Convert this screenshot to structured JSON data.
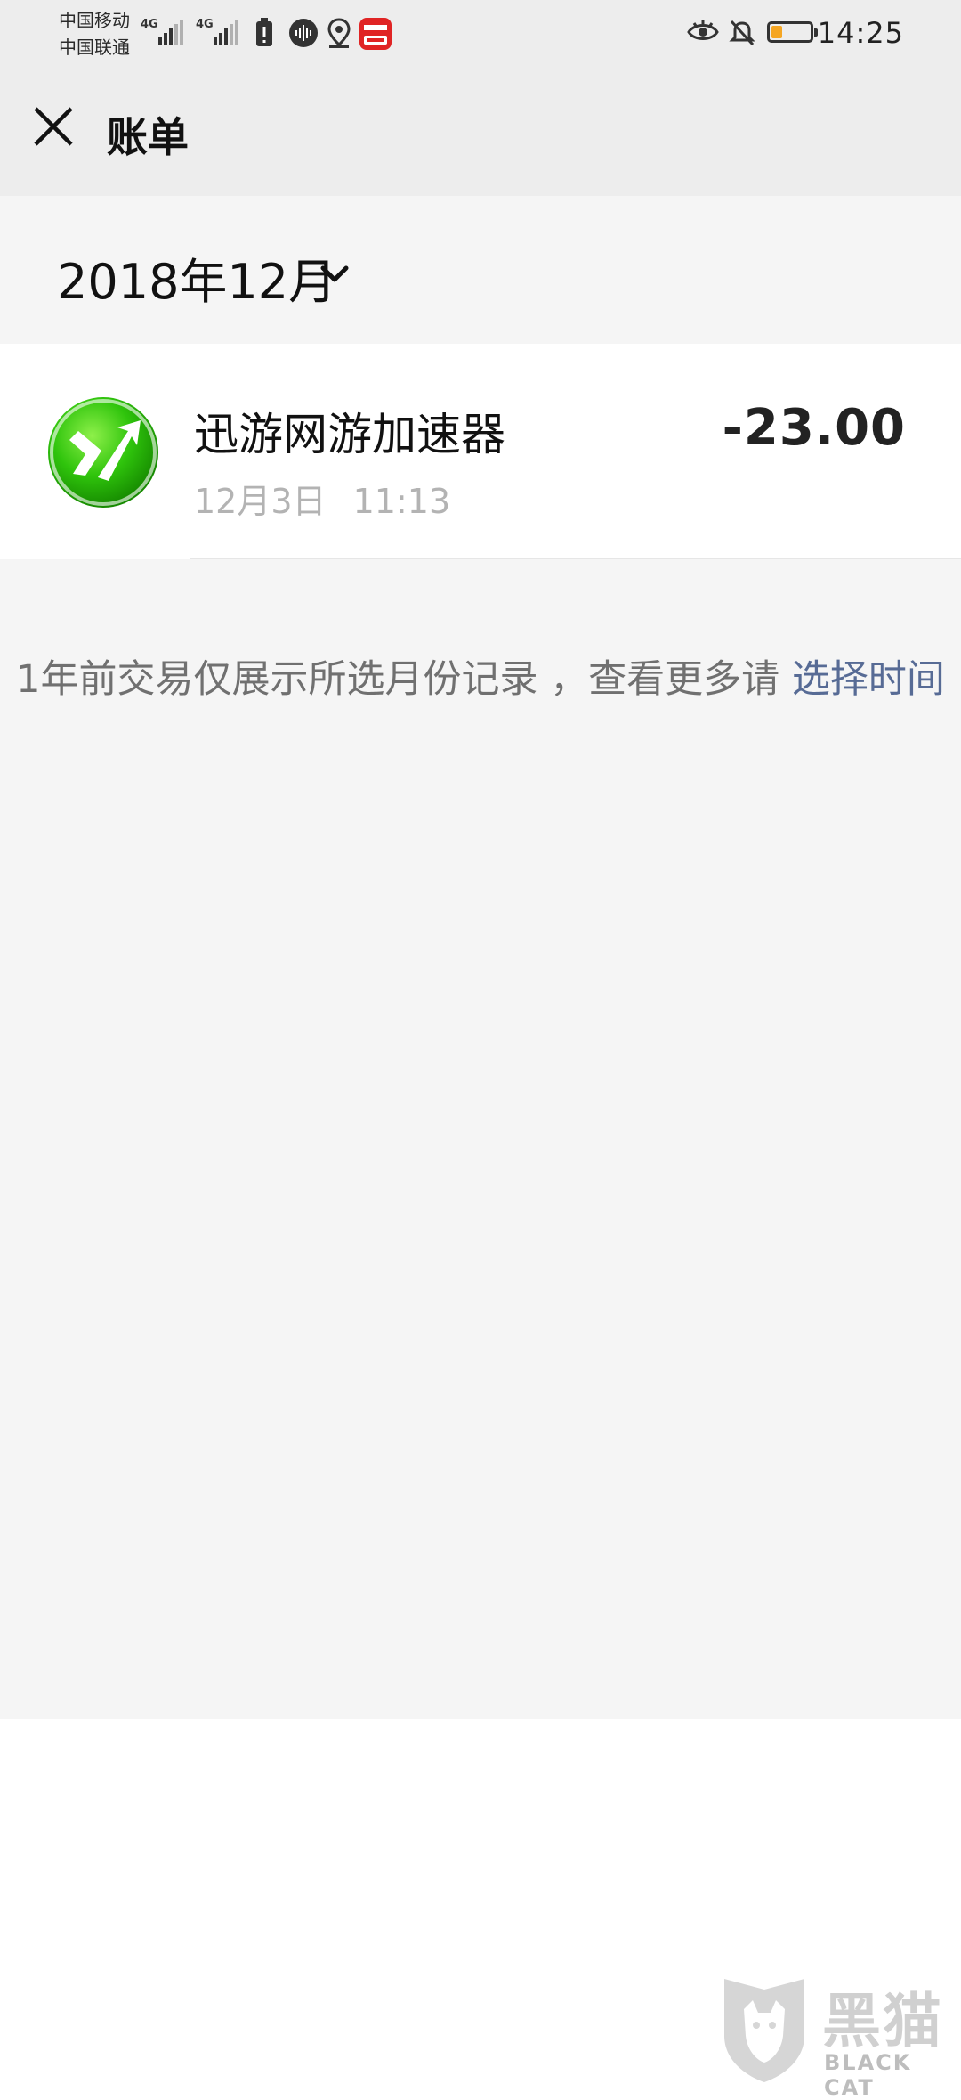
{
  "status_bar": {
    "carrier_1": "中国移动",
    "carrier_2": "中国联通",
    "network_1": "4G",
    "network_2": "4G",
    "time": "14:25",
    "battery_color": "#f5a623"
  },
  "nav": {
    "title": "账单",
    "close_icon": "close-icon"
  },
  "month_selector": {
    "label": "2018年12月",
    "icon": "chevron-down-icon"
  },
  "transactions": [
    {
      "name": "迅游网游加速器",
      "date": "12月3日 11:13",
      "amount": "-23.00",
      "icon": "xunyou-app-icon"
    }
  ],
  "notice": {
    "text": "1年前交易仅展示所选月份记录 ，查看更多请",
    "link": "选择时间",
    "link_color": "#576b95"
  },
  "watermark": {
    "text": "黑猫",
    "sub": "BLACK CAT"
  }
}
